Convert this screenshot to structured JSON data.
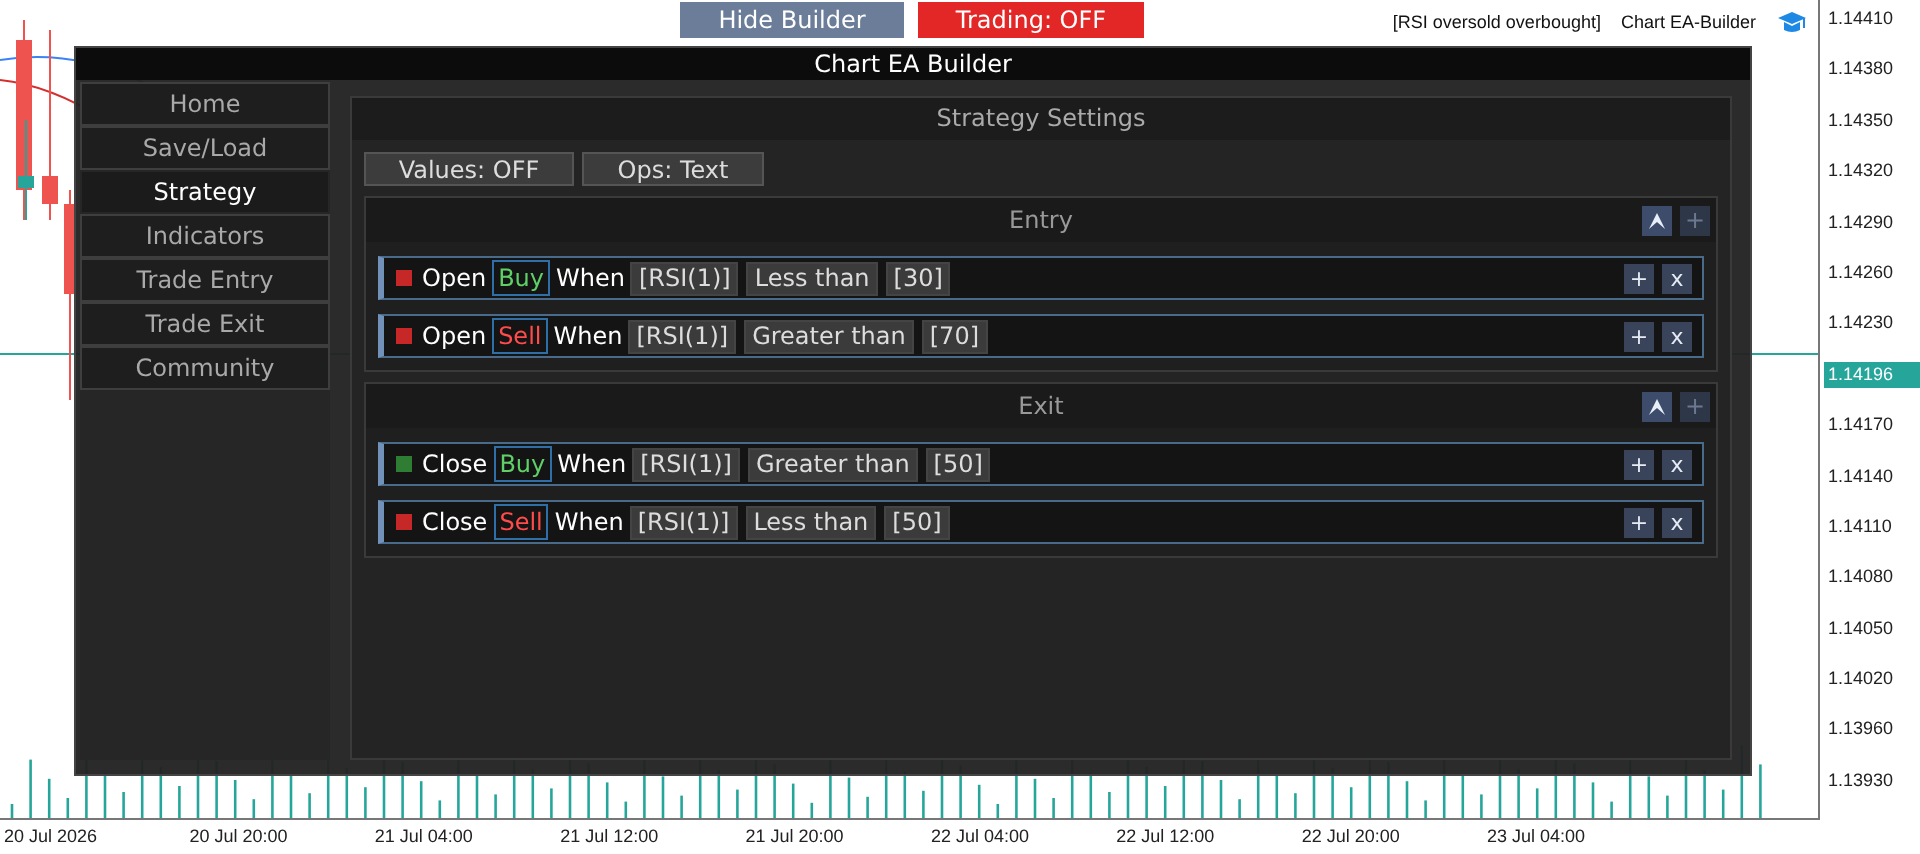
{
  "toolbar": {
    "buttons": [
      {
        "label": "Hide Builder",
        "kind": "neutral"
      },
      {
        "label": "Trading: OFF",
        "kind": "danger"
      }
    ]
  },
  "chart": {
    "indicator_label": "[RSI oversold overbought]",
    "ea_label": "Chart EA-Builder",
    "price_ticks": [
      {
        "label": "1.14410",
        "kind": "tick"
      },
      {
        "label": "1.14380",
        "kind": "tick"
      },
      {
        "label": "1.14350",
        "kind": "tick"
      },
      {
        "label": "1.14320",
        "kind": "tick"
      },
      {
        "label": "1.14290",
        "kind": "tick"
      },
      {
        "label": "1.14260",
        "kind": "tick"
      },
      {
        "label": "1.14230",
        "kind": "tick"
      },
      {
        "label": "1.14196",
        "kind": "current"
      },
      {
        "label": "1.14170",
        "kind": "tick"
      },
      {
        "label": "1.14140",
        "kind": "tick"
      },
      {
        "label": "1.14110",
        "kind": "tick"
      },
      {
        "label": "1.14080",
        "kind": "tick"
      },
      {
        "label": "1.14050",
        "kind": "tick"
      },
      {
        "label": "1.14020",
        "kind": "tick"
      },
      {
        "label": "1.13960",
        "kind": "tick"
      },
      {
        "label": "1.13930",
        "kind": "tick"
      }
    ],
    "time_ticks": [
      "20 Jul 2026",
      "20 Jul 20:00",
      "21 Jul 04:00",
      "21 Jul 12:00",
      "21 Jul 20:00",
      "22 Jul 04:00",
      "22 Jul 12:00",
      "22 Jul 20:00",
      "23 Jul 04:00"
    ]
  },
  "panel": {
    "title": "Chart EA Builder",
    "nav": [
      {
        "label": "Home",
        "selected": false
      },
      {
        "label": "Save/Load",
        "selected": false
      },
      {
        "label": "Strategy",
        "selected": true
      },
      {
        "label": "Indicators",
        "selected": false
      },
      {
        "label": "Trade Entry",
        "selected": false
      },
      {
        "label": "Trade Exit",
        "selected": false
      },
      {
        "label": "Community",
        "selected": false
      }
    ],
    "header": "Strategy Settings",
    "toggles": [
      "Values: OFF",
      "Ops: Text"
    ],
    "sections": [
      {
        "title": "Entry",
        "add": {
          "label": "+",
          "disabled": true
        },
        "rules": [
          {
            "color": "#c62828",
            "action": "Open",
            "side": {
              "label": "Buy",
              "color": "#5fd068"
            },
            "when": "When",
            "indicator": "[RSI(1)]",
            "operator": "Less than",
            "value": "[30]",
            "add": "+",
            "remove": "x"
          },
          {
            "color": "#c62828",
            "action": "Open",
            "side": {
              "label": "Sell",
              "color": "#ff4b4b"
            },
            "when": "When",
            "indicator": "[RSI(1)]",
            "operator": "Greater than",
            "value": "[70]",
            "add": "+",
            "remove": "x"
          }
        ]
      },
      {
        "title": "Exit",
        "add": {
          "label": "+",
          "disabled": true
        },
        "rules": [
          {
            "color": "#2e7d32",
            "action": "Close",
            "side": {
              "label": "Buy",
              "color": "#5fd068"
            },
            "when": "When",
            "indicator": "[RSI(1)]",
            "operator": "Greater than",
            "value": "[50]",
            "add": "+",
            "remove": "x"
          },
          {
            "color": "#c62828",
            "action": "Close",
            "side": {
              "label": "Sell",
              "color": "#ff4b4b"
            },
            "when": "When",
            "indicator": "[RSI(1)]",
            "operator": "Less than",
            "value": "[50]",
            "add": "+",
            "remove": "x"
          }
        ]
      }
    ]
  }
}
